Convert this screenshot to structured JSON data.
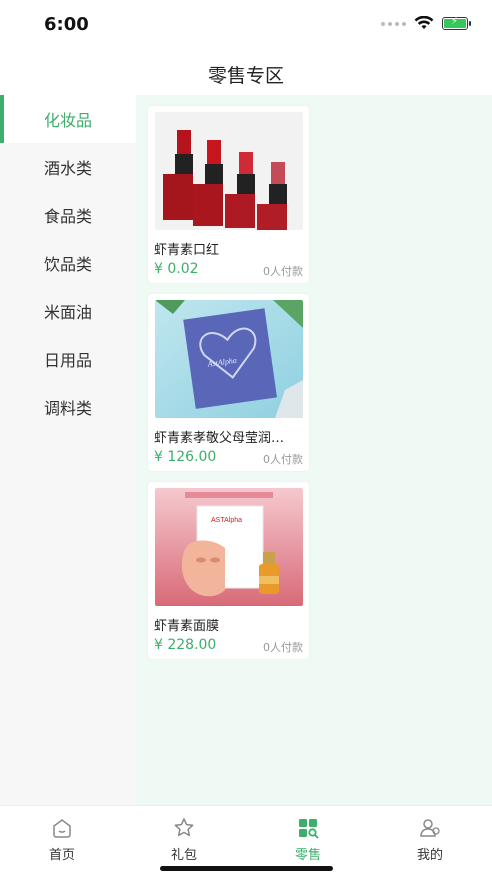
{
  "status_bar": {
    "time": "6:00"
  },
  "header": {
    "title": "零售专区"
  },
  "sidebar": {
    "items": [
      {
        "label": "化妆品",
        "active": true
      },
      {
        "label": "酒水类",
        "active": false
      },
      {
        "label": "食品类",
        "active": false
      },
      {
        "label": "饮品类",
        "active": false
      },
      {
        "label": "米面油",
        "active": false
      },
      {
        "label": "日用品",
        "active": false
      },
      {
        "label": "调料类",
        "active": false
      }
    ]
  },
  "products": [
    {
      "name": "虾青素口红",
      "price": "¥ 0.02",
      "paid": "0人付款",
      "image": "lipsticks"
    },
    {
      "name": "虾青素孝敬父母莹润…",
      "price": "¥ 126.00",
      "paid": "0人付款",
      "image": "mask-pack"
    },
    {
      "name": "虾青素面膜",
      "price": "¥ 228.00",
      "paid": "0人付款",
      "image": "face-mask"
    }
  ],
  "images": {
    "mask_pack_brand": "AstAlpha",
    "face_mask_brand": "ASTAlpha"
  },
  "tabbar": {
    "tabs": [
      {
        "label": "首页",
        "icon": "home-icon",
        "active": false
      },
      {
        "label": "礼包",
        "icon": "star-icon",
        "active": false
      },
      {
        "label": "零售",
        "icon": "retail-icon",
        "active": true
      },
      {
        "label": "我的",
        "icon": "user-icon",
        "active": false
      }
    ]
  },
  "colors": {
    "accent": "#3dae6b",
    "content_bg": "#f0faf4",
    "sidebar_bg": "#f7f7f7"
  }
}
